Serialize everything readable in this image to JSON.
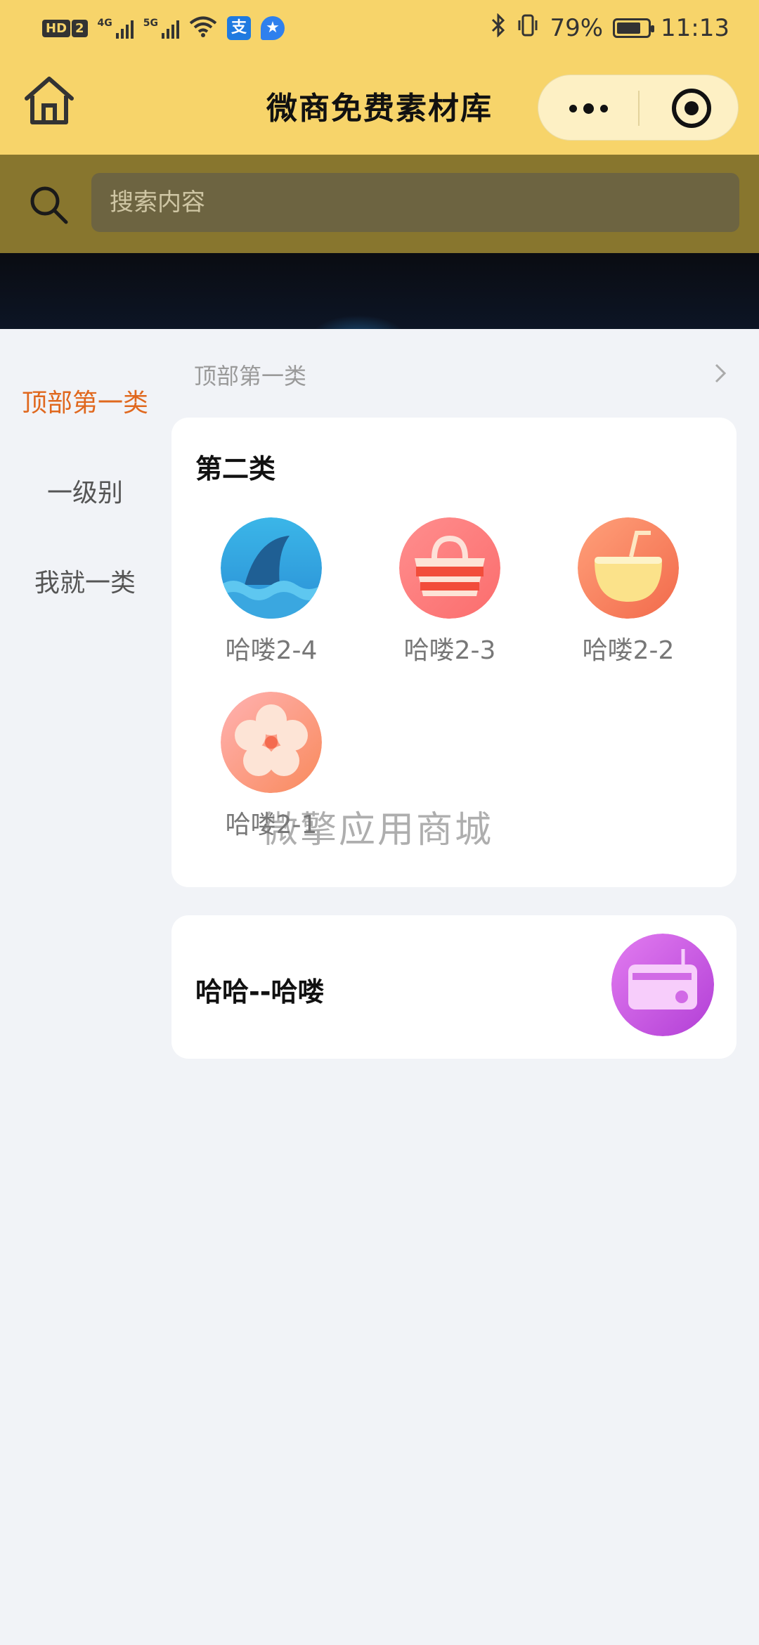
{
  "status_bar": {
    "hd_label": "HD",
    "hd_sim": "2",
    "net1": "4G",
    "net2": "5G",
    "app1_icon": "alipay-icon",
    "app1_glyph": "支",
    "app2_icon": "badge-star-icon",
    "app2_glyph": "★",
    "battery_percent": "79%",
    "battery_level": 0.79,
    "time": "11:13"
  },
  "header": {
    "title": "微商免费素材库",
    "home_icon": "home-icon",
    "more_icon": "more-dots-icon",
    "close_icon": "target-close-icon",
    "background_color": "#f7d46a"
  },
  "search": {
    "placeholder": "搜索内容",
    "icon": "search-icon"
  },
  "sidebar": {
    "items": [
      {
        "label": "顶部第一类",
        "active": true
      },
      {
        "label": "一级别",
        "active": false
      },
      {
        "label": "我就一类",
        "active": false
      }
    ],
    "active_color": "#e0681e"
  },
  "main": {
    "breadcrumb": "顶部第一类",
    "breadcrumb_icon": "chevron-right-icon",
    "section": {
      "title": "第二类",
      "items": [
        {
          "label": "哈喽2-4",
          "icon": "shark-fin-icon"
        },
        {
          "label": "哈喽2-3",
          "icon": "basket-icon"
        },
        {
          "label": "哈喽2-2",
          "icon": "coconut-drink-icon"
        },
        {
          "label": "哈喽2-1",
          "icon": "flower-icon"
        }
      ]
    },
    "watermark": "微擎应用商城",
    "row": {
      "title": "哈哈--哈喽",
      "icon": "radio-icon"
    }
  }
}
